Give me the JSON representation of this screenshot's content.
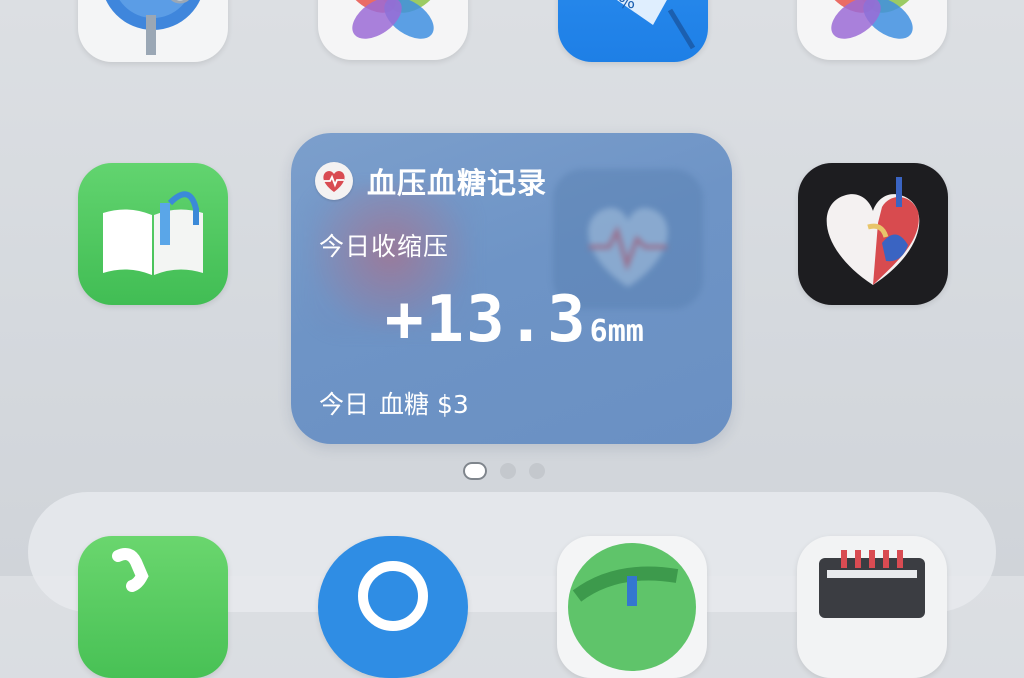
{
  "home_screen": {
    "top_row": [
      {
        "name": "medical-app-icon"
      },
      {
        "name": "photos-icon"
      },
      {
        "name": "weather-app-icon"
      },
      {
        "name": "photos-icon"
      }
    ],
    "middle_row": [
      {
        "name": "books-icon"
      },
      {
        "name": "heart-health-app-icon"
      }
    ],
    "dock": [
      {
        "name": "phone-icon"
      },
      {
        "name": "safari-icon"
      },
      {
        "name": "browser-icon"
      },
      {
        "name": "music-app-icon"
      }
    ]
  },
  "widget": {
    "title": "血压血糖记录",
    "subtitle": "今日收缩压",
    "value": "+13.3",
    "unit": "6mm",
    "footer_label": "今日",
    "footer_value": "血糖 $3",
    "accent_color": "#6e94c6",
    "badge_color": "#d94b52"
  },
  "page_indicator": {
    "total_pages": 3,
    "current_page": 1
  }
}
